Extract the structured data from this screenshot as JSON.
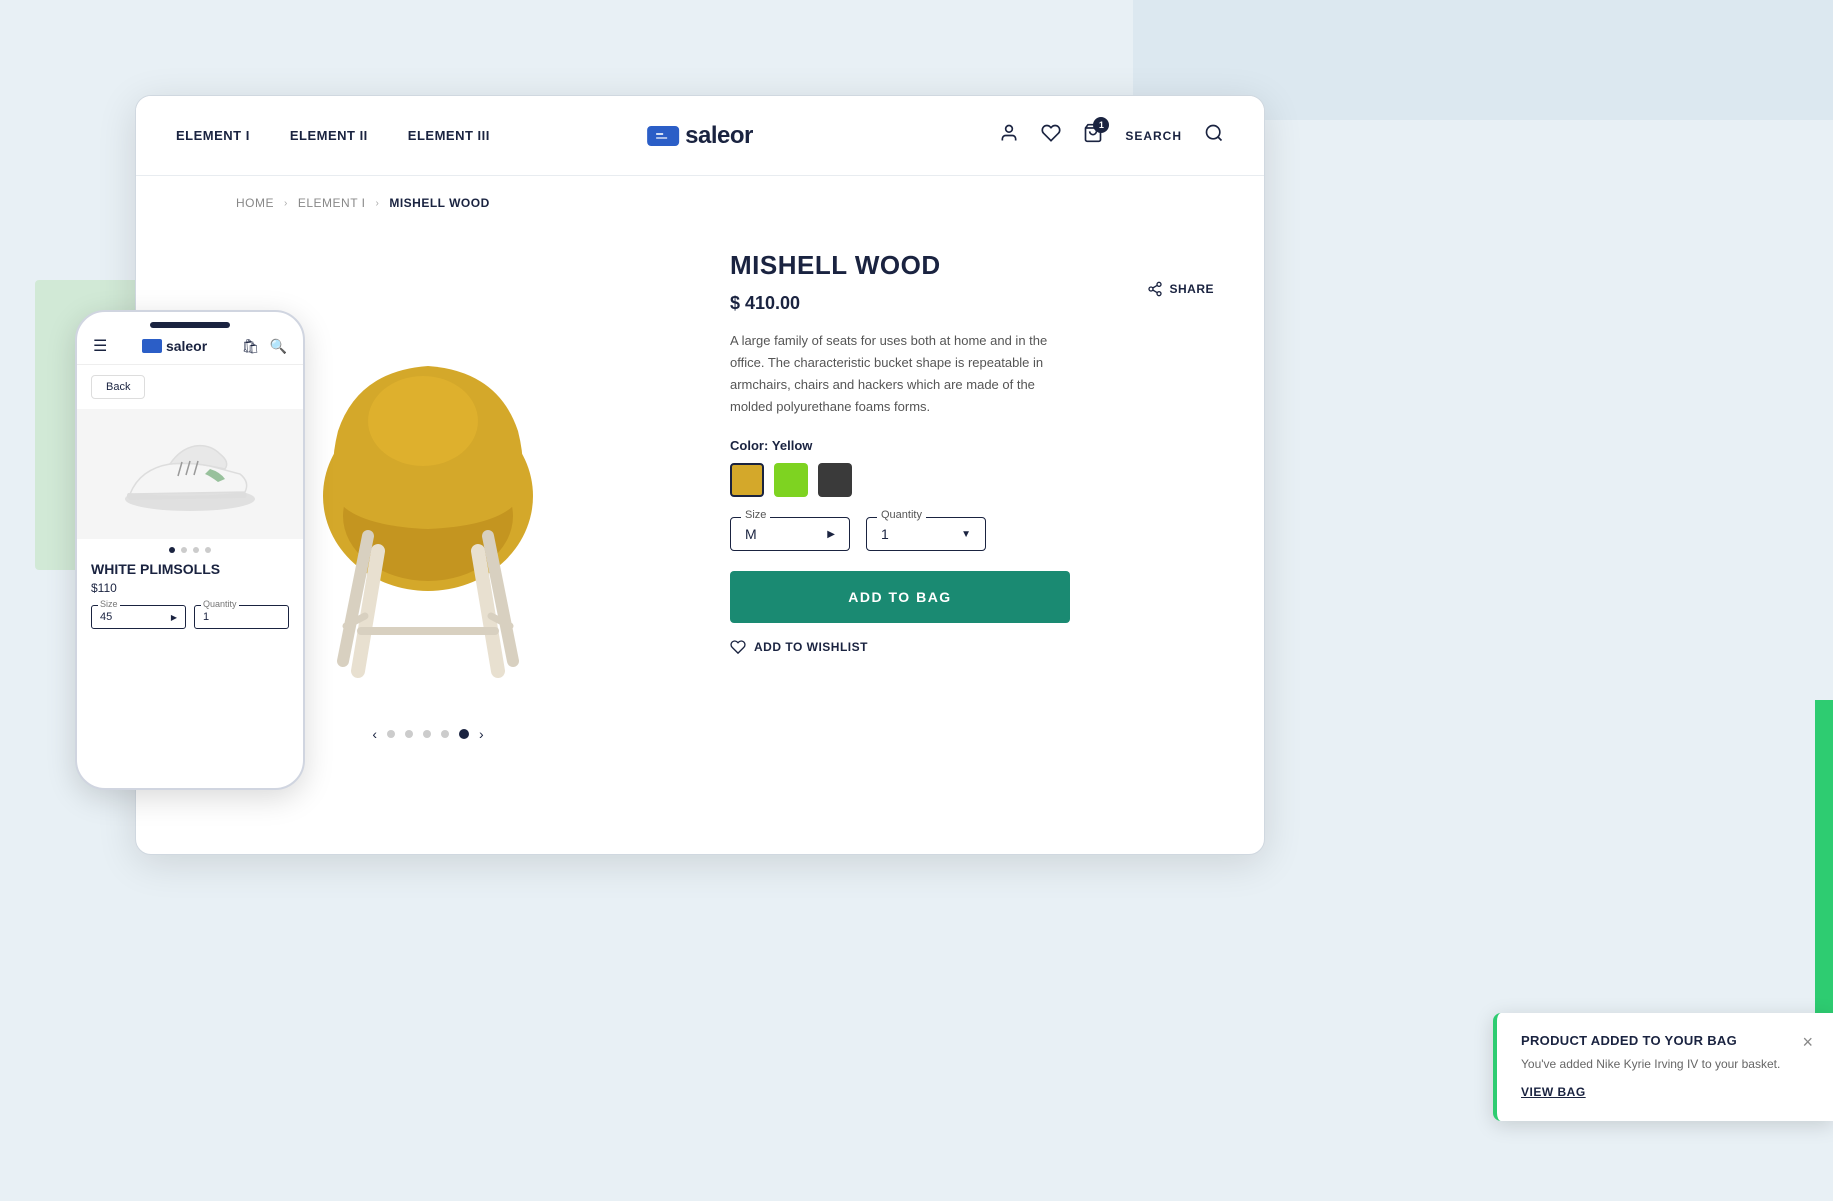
{
  "page": {
    "background_color": "#e8f0f5"
  },
  "navbar": {
    "nav_links": [
      {
        "label": "ELEMENT I",
        "id": "element-1"
      },
      {
        "label": "ELEMENT II",
        "id": "element-2"
      },
      {
        "label": "ELEMENT III",
        "id": "element-3"
      }
    ],
    "logo_text": "saleor",
    "search_label": "SEARCH",
    "cart_badge": "1"
  },
  "breadcrumb": {
    "home": "HOME",
    "category": "ELEMENT I",
    "product": "MISHELL WOOD"
  },
  "share_button": "SHARE",
  "product": {
    "title": "MISHELL WOOD",
    "price": "$ 410.00",
    "description": "A large family of seats for uses both at home and in the office. The characteristic bucket shape is repeatable in armchairs, chairs and hackers which are made of the molded polyurethane foams forms.",
    "color_label": "Color:",
    "color_selected": "Yellow",
    "colors": [
      {
        "name": "yellow",
        "hex": "#d4a82a"
      },
      {
        "name": "green",
        "hex": "#7ed321"
      },
      {
        "name": "dark",
        "hex": "#3a3a3a"
      }
    ],
    "size_label": "Size",
    "size_value": "M",
    "quantity_label": "Quantity",
    "quantity_value": "1",
    "add_to_bag": "ADD TO BAG",
    "add_to_wishlist": "ADD TO WISHLIST"
  },
  "carousel": {
    "dots_count": 5,
    "active_dot": 4
  },
  "mobile": {
    "logo_text": "saleor",
    "back_label": "Back",
    "product_title": "WHITE PLIMSOLLS",
    "product_price": "$110",
    "size_label": "Size",
    "size_value": "45",
    "quantity_label": "Quantity",
    "quantity_value": "1",
    "dots_count": 4,
    "active_dot": 0
  },
  "toast": {
    "title": "PRODUCT ADDED TO YOUR BAG",
    "message": "You've added Nike Kyrie Irving IV to your basket.",
    "view_bag_label": "VIEW BAG",
    "close_icon": "×"
  }
}
